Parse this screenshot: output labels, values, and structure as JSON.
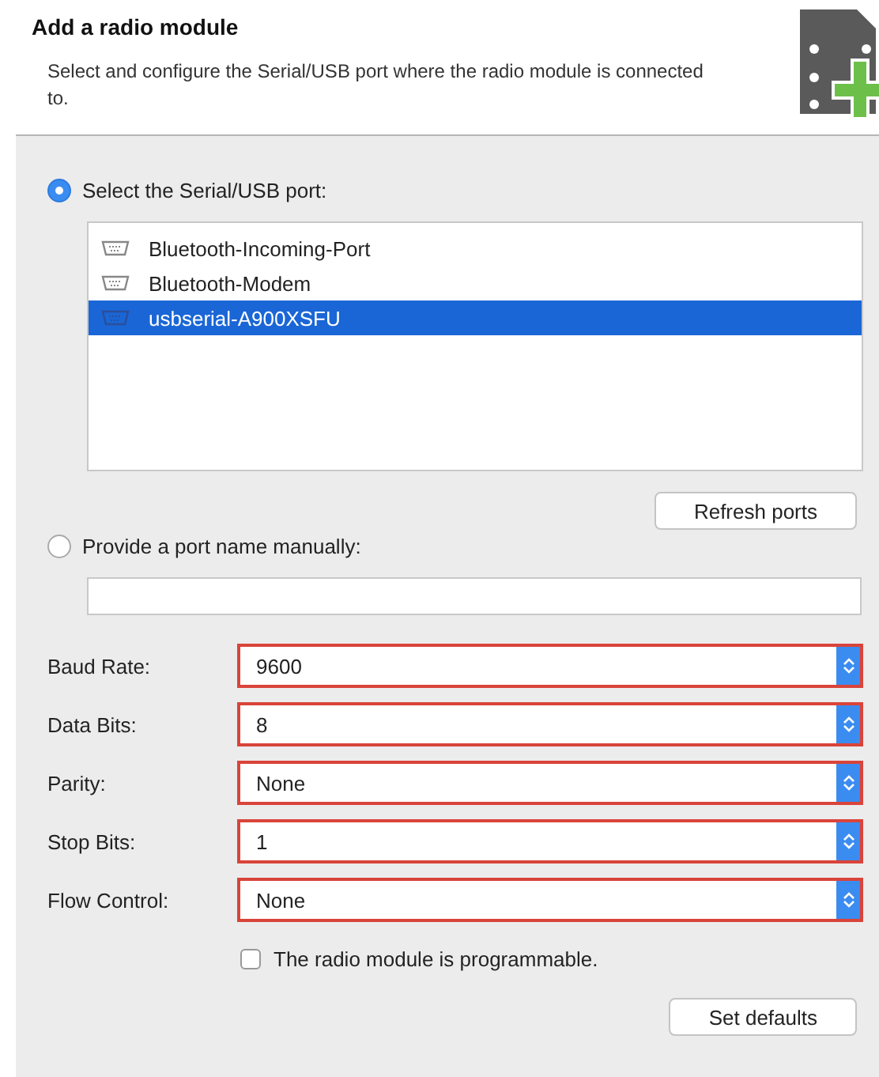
{
  "header": {
    "title": "Add a radio module",
    "description": "Select and configure the Serial/USB port where the radio module is connected to."
  },
  "port_source": [
    {
      "label": "Select the Serial/USB port:",
      "selected": true
    },
    {
      "label": "Provide a port name manually:",
      "selected": false
    }
  ],
  "ports": [
    {
      "name": "Bluetooth-Incoming-Port",
      "selected": false
    },
    {
      "name": "Bluetooth-Modem",
      "selected": false
    },
    {
      "name": "usbserial-A900XSFU",
      "selected": true
    }
  ],
  "refresh_button": "Refresh ports",
  "settings": [
    {
      "label": "Baud Rate:",
      "value": "9600",
      "highlighted": true
    },
    {
      "label": "Data Bits:",
      "value": "8",
      "highlighted": true
    },
    {
      "label": "Parity:",
      "value": "None",
      "highlighted": true
    },
    {
      "label": "Stop Bits:",
      "value": "1",
      "highlighted": true
    },
    {
      "label": "Flow Control:",
      "value": "None",
      "highlighted": true
    }
  ],
  "programmable": {
    "label": "The radio module is programmable.",
    "checked": false
  },
  "defaults_button": "Set defaults"
}
